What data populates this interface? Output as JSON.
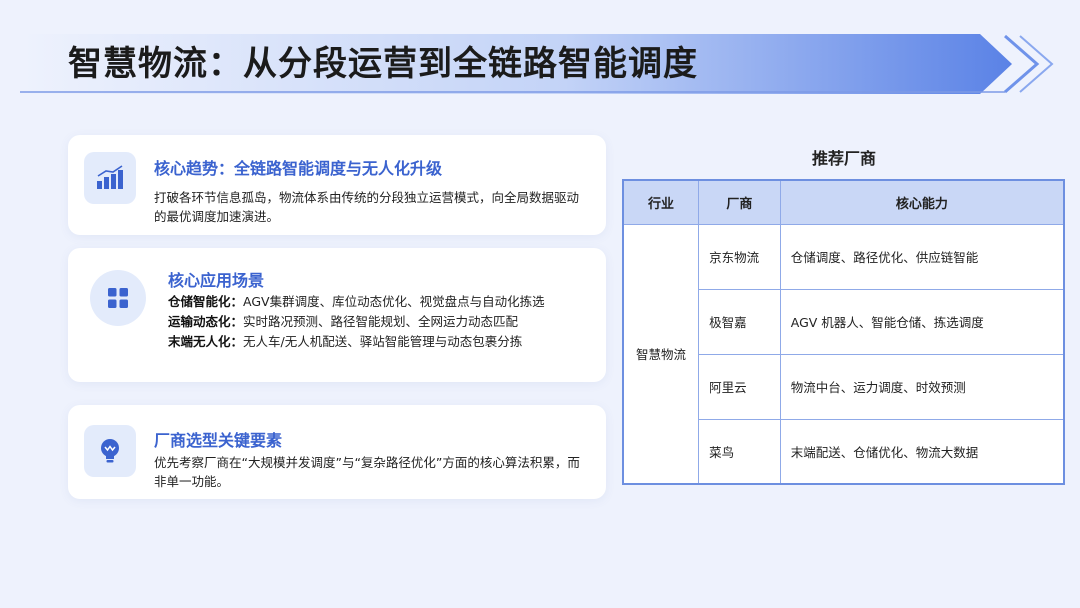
{
  "page": {
    "title": "智慧物流：从分段运营到全链路智能调度"
  },
  "cards": {
    "trend": {
      "icon": "bar-chart-icon",
      "title": "核心趋势：全链路智能调度与无人化升级",
      "body": "打破各环节信息孤岛，物流体系由传统的分段独立运营模式，向全局数据驱动的最优调度加速演进。"
    },
    "scenarios": {
      "icon": "grid-icon",
      "title": "核心应用场景",
      "items": [
        {
          "label": "仓储智能化：",
          "text": "AGV集群调度、库位动态优化、视觉盘点与自动化拣选"
        },
        {
          "label": "运输动态化：",
          "text": "实时路况预测、路径智能规划、全网运力动态匹配"
        },
        {
          "label": "末端无人化：",
          "text": "无人车/无人机配送、驿站智能管理与动态包裹分拣"
        }
      ]
    },
    "selection": {
      "icon": "lightbulb-icon",
      "title": "厂商选型关键要素",
      "body": "优先考察厂商在“大规模并发调度”与“复杂路径优化”方面的核心算法积累，而非单一功能。"
    }
  },
  "vendors": {
    "title": "推荐厂商",
    "headers": [
      "行业",
      "厂商",
      "核心能力"
    ],
    "industry": "智慧物流",
    "rows": [
      {
        "vendor": "京东物流",
        "capability": "仓储调度、路径优化、供应链智能"
      },
      {
        "vendor": "极智嘉",
        "capability": "AGV 机器人、智能仓储、拣选调度"
      },
      {
        "vendor": "阿里云",
        "capability": "物流中台、运力调度、时效预测"
      },
      {
        "vendor": "菜鸟",
        "capability": "末端配送、仓储优化、物流大数据"
      }
    ]
  },
  "colors": {
    "accent": "#3b63cf",
    "band": "#6d8fe0",
    "table_header": "#c9d7f6",
    "background": "#eef2fd"
  }
}
